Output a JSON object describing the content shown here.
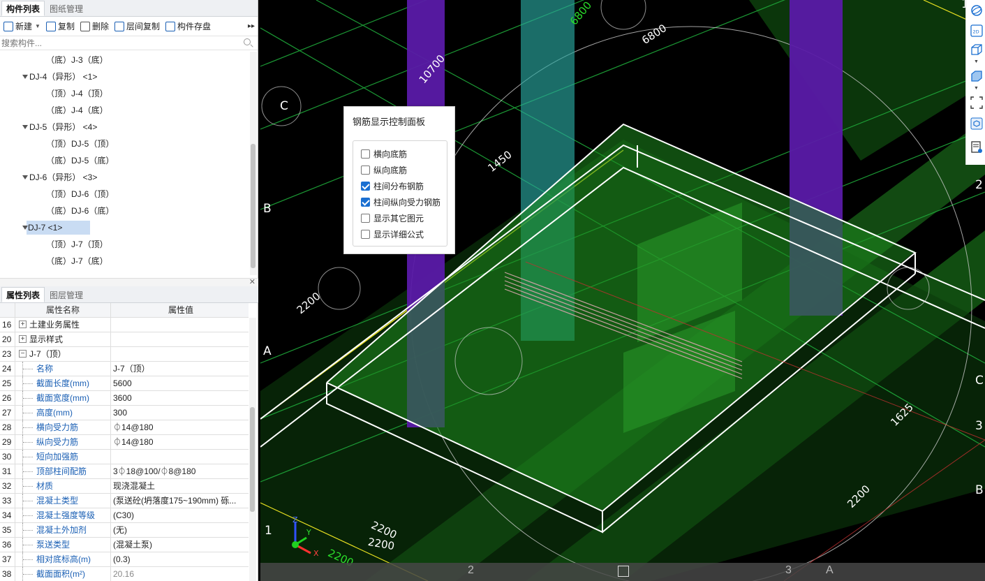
{
  "component_tabs": [
    "构件列表",
    "图纸管理"
  ],
  "toolbar": {
    "new_label": "新建",
    "copy_label": "复制",
    "delete_label": "删除",
    "floor_copy_label": "层间复制",
    "save_label": "构件存盘"
  },
  "search": {
    "placeholder": "搜索构件..."
  },
  "tree": [
    {
      "level": 2,
      "label": "（底）J-3（底）"
    },
    {
      "level": 1,
      "label": "DJ-4（异形） <1>"
    },
    {
      "level": 2,
      "label": "（顶）J-4（顶）"
    },
    {
      "level": 2,
      "label": "（底）J-4（底）"
    },
    {
      "level": 1,
      "label": "DJ-5（异形） <4>"
    },
    {
      "level": 2,
      "label": "（顶）DJ-5（顶）"
    },
    {
      "level": 2,
      "label": "（底）DJ-5（底）"
    },
    {
      "level": 1,
      "label": "DJ-6（异形） <3>"
    },
    {
      "level": 2,
      "label": "（顶）DJ-6（顶）"
    },
    {
      "level": 2,
      "label": "（底）DJ-6（底）"
    },
    {
      "level": 1,
      "label": "DJ-7 <1>",
      "selected": true
    },
    {
      "level": 2,
      "label": "（顶）J-7（顶）"
    },
    {
      "level": 2,
      "label": "（底）J-7（底）"
    }
  ],
  "property_tabs": [
    "属性列表",
    "图层管理"
  ],
  "property_headers": {
    "name": "属性名称",
    "value": "属性值"
  },
  "properties": [
    {
      "num": "16",
      "name": "土建业务属性",
      "value": "",
      "kind": "group",
      "box": "+"
    },
    {
      "num": "20",
      "name": "显示样式",
      "value": "",
      "kind": "group",
      "box": "+"
    },
    {
      "num": "23",
      "name": "J-7（顶）",
      "value": "",
      "kind": "group",
      "box": "−"
    },
    {
      "num": "24",
      "name": "名称",
      "value": "J-7（顶）",
      "kind": "item"
    },
    {
      "num": "25",
      "name": "截面长度(mm)",
      "value": "5600",
      "kind": "item"
    },
    {
      "num": "26",
      "name": "截面宽度(mm)",
      "value": "3600",
      "kind": "item"
    },
    {
      "num": "27",
      "name": "高度(mm)",
      "value": "300",
      "kind": "item"
    },
    {
      "num": "28",
      "name": "横向受力筋",
      "value": "⏀14@180",
      "kind": "item"
    },
    {
      "num": "29",
      "name": "纵向受力筋",
      "value": "⏀14@180",
      "kind": "item"
    },
    {
      "num": "30",
      "name": "短向加强筋",
      "value": "",
      "kind": "item"
    },
    {
      "num": "31",
      "name": "顶部柱间配筋",
      "value": "3⏀18@100/⏀8@180",
      "kind": "item"
    },
    {
      "num": "32",
      "name": "材质",
      "value": "现浇混凝土",
      "kind": "item"
    },
    {
      "num": "33",
      "name": "混凝土类型",
      "value": "(泵送砼(坍落度175~190mm) 砾...",
      "kind": "item"
    },
    {
      "num": "34",
      "name": "混凝土强度等级",
      "value": "(C30)",
      "kind": "item"
    },
    {
      "num": "35",
      "name": "混凝土外加剂",
      "value": "(无)",
      "kind": "item"
    },
    {
      "num": "36",
      "name": "泵送类型",
      "value": "(混凝土泵)",
      "kind": "item"
    },
    {
      "num": "37",
      "name": "相对底标高(m)",
      "value": "(0.3)",
      "kind": "item"
    },
    {
      "num": "38",
      "name": "截面面积(m²)",
      "value": "20.16",
      "kind": "item",
      "grey": true
    }
  ],
  "rebar_panel": {
    "title": "钢筋显示控制面板",
    "options": [
      {
        "label": "横向底筋",
        "checked": false
      },
      {
        "label": "纵向底筋",
        "checked": false
      },
      {
        "label": "柱间分布钢筋",
        "checked": true
      },
      {
        "label": "柱间纵向受力钢筋",
        "checked": true
      },
      {
        "label": "显示其它图元",
        "checked": false
      },
      {
        "label": "显示详细公式",
        "checked": false
      }
    ]
  },
  "viewport": {
    "grid_labels": [
      "C",
      "B",
      "A",
      "1",
      "2",
      "C",
      "3",
      "B",
      "1",
      "2",
      "3",
      "A"
    ],
    "dim_labels": [
      "10700",
      "6800",
      "6800",
      "1450",
      "2200",
      "2200",
      "2200",
      "2200",
      "1625",
      "2200"
    ],
    "axis_labels": {
      "z": "Z",
      "y": "Y",
      "x": "X"
    }
  },
  "colors": {
    "accent": "#1a6fd1",
    "column_purple": "#5a1aa8",
    "column_cyan": "#2aa8a0",
    "slab_green": "#1e7a1e",
    "background": "#000000"
  }
}
